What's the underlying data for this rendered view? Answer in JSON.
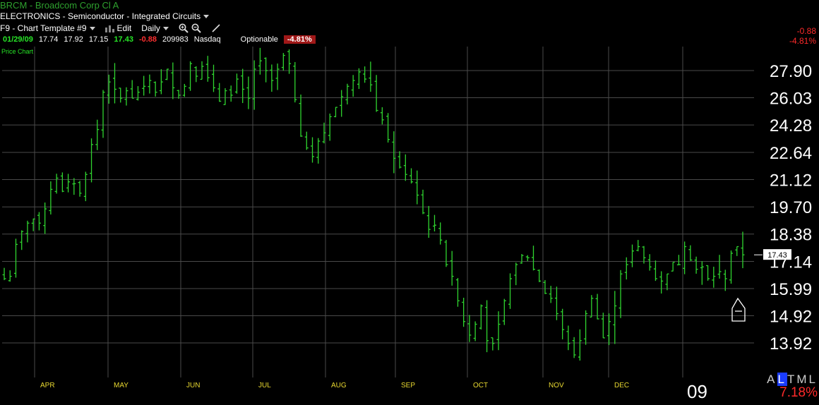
{
  "header": {
    "title": "BRCM - Broadcom Corp Cl A",
    "sector": "ELECTRONICS - Semiconductor - Integrated Circuits",
    "template": "F9 - Chart Template #9",
    "edit": "Edit",
    "period": "Daily"
  },
  "quote": {
    "date": "01/29/09",
    "open": "17.74",
    "high": "17.92",
    "low": "17.15",
    "last": "17.43",
    "change": "-0.88",
    "volume": "209983",
    "exchange": "Nasdaq",
    "optionable": "Optionable",
    "change_pct": "-4.81%"
  },
  "pane_label": "Price Chart",
  "right_change": "-0.88",
  "right_change_pct": "-4.81%",
  "bottom_tabs": {
    "a": "A",
    "l": "L",
    "t": "T",
    "m": "M",
    "l2": "L"
  },
  "bottom_pct": "7.18%",
  "year_label": "09",
  "colors": {
    "bars": "#2fd42f",
    "grid": "#4a4a4a",
    "axis_text": "#e8d830",
    "negative": "#ff2a2a"
  },
  "chart_data": {
    "type": "ohlc",
    "title": "BRCM - Broadcom Corp Cl A",
    "ylim": [
      13.2,
      30.0
    ],
    "y_scale": "log",
    "y_ticks": [
      27.9,
      26.03,
      24.28,
      22.64,
      21.12,
      19.7,
      18.38,
      17.14,
      15.99,
      14.92,
      13.92
    ],
    "y_tick_labels": [
      "27.90",
      "26.03",
      "24.28",
      "22.64",
      "21.12",
      "19.70",
      "18.38",
      "17.14",
      "15.99",
      "14.92",
      "13.92"
    ],
    "x_month_labels": [
      "APR",
      "MAY",
      "JUN",
      "JUL",
      "AUG",
      "SEP",
      "OCT",
      "NOV",
      "DEC"
    ],
    "year_marker": "09",
    "last_price": 17.43,
    "grid": true,
    "closes": [
      16.4,
      16.5,
      17.9,
      18.5,
      18.9,
      19.1,
      18.9,
      19.6,
      20.6,
      21.2,
      20.5,
      21.0,
      20.9,
      20.4,
      21.4,
      23.1,
      24.0,
      26.4,
      27.1,
      26.6,
      26.0,
      26.5,
      26.0,
      26.4,
      26.8,
      27.2,
      26.4,
      27.1,
      28.0,
      26.7,
      26.2,
      26.8,
      28.4,
      27.5,
      28.2,
      27.4,
      26.7,
      25.8,
      26.5,
      26.2,
      27.3,
      26.6,
      26.0,
      28.0,
      28.6,
      27.9,
      27.2,
      28.0,
      29.0,
      28.4,
      25.9,
      23.6,
      22.9,
      22.4,
      23.3,
      23.8,
      24.8,
      25.4,
      26.1,
      26.8,
      27.2,
      27.8,
      27.3,
      26.9,
      25.2,
      24.6,
      23.4,
      22.3,
      21.8,
      21.4,
      21.0,
      20.3,
      19.4,
      18.6,
      18.8,
      18.1,
      17.0,
      16.5,
      15.5,
      14.7,
      14.2,
      14.6,
      15.3,
      14.0,
      13.9,
      14.6,
      15.5,
      16.4,
      17.0,
      17.4,
      17.3,
      16.8,
      16.3,
      15.8,
      15.6,
      15.0,
      14.4,
      13.9,
      13.5,
      14.0,
      15.0,
      15.6,
      14.8,
      14.1,
      14.7,
      15.3,
      16.6,
      17.0,
      17.6,
      17.8,
      17.3,
      16.9,
      16.4,
      16.3,
      16.6,
      17.1,
      17.0,
      17.8,
      17.2,
      16.8,
      16.9,
      16.4,
      16.5,
      16.7,
      16.4,
      17.5,
      17.8,
      17.43
    ]
  }
}
